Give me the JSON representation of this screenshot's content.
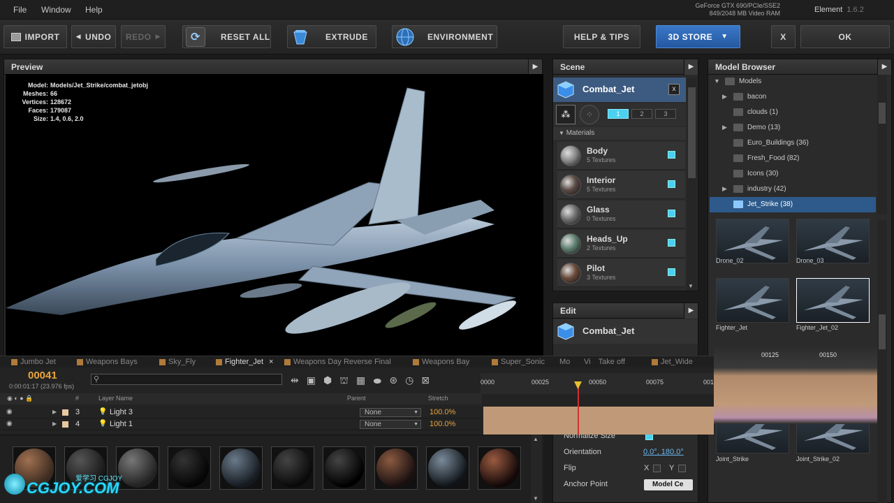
{
  "menu": {
    "file": "File",
    "window": "Window",
    "help": "Help"
  },
  "gpu": {
    "line1": "GeForce GTX 690/PCIe/SSE2",
    "line2": "849/2048 MB Video RAM"
  },
  "app": {
    "name": "Element",
    "version": "1.6.2"
  },
  "toolbar": {
    "import": "IMPORT",
    "undo": "UNDO",
    "redo": "REDO",
    "reset_all": "RESET ALL",
    "extrude": "EXTRUDE",
    "environment": "ENVIRONMENT",
    "help_tips": "HELP & TIPS",
    "store": "3D STORE",
    "close": "X",
    "ok": "OK"
  },
  "preview": {
    "title": "Preview",
    "info": [
      {
        "k": "Model:",
        "v": "Models/Jet_Strike/combat_jetobj"
      },
      {
        "k": "Meshes:",
        "v": "66"
      },
      {
        "k": "Vertices:",
        "v": "128672"
      },
      {
        "k": "Faces:",
        "v": "179087"
      },
      {
        "k": "Size:",
        "v": "1.4, 0.6, 2.0"
      }
    ]
  },
  "scene": {
    "title": "Scene",
    "object_name": "Combat_Jet",
    "close": "x",
    "groups": [
      "1",
      "2",
      "3"
    ],
    "materials_label": "Materials",
    "materials": [
      {
        "name": "Body",
        "sub": "5 Textures",
        "color": "#8a8a8a"
      },
      {
        "name": "Interior",
        "sub": "5 Textures",
        "color": "#5a4a44"
      },
      {
        "name": "Glass",
        "sub": "0 Textures",
        "color": "#707070"
      },
      {
        "name": "Heads_Up",
        "sub": "2 Textures",
        "color": "#5f8070"
      },
      {
        "name": "Pilot",
        "sub": "3 Textures",
        "color": "#6a4a3a"
      }
    ]
  },
  "edit": {
    "title": "Edit",
    "object_name": "Combat_Jet",
    "normalize_size": "Normalize Size",
    "orientation": "Orientation",
    "orientation_value": "0.0°, 180.0°",
    "flip": "Flip",
    "flip_x": "X",
    "flip_y": "Y",
    "anchor_point": "Anchor Point",
    "anchor_value": "Model Ce"
  },
  "browser": {
    "title": "Model Browser",
    "tree": [
      {
        "label": "Models",
        "indent": 0,
        "arrow": "▼",
        "state": "open"
      },
      {
        "label": "bacon",
        "indent": 1,
        "arrow": "▶",
        "state": ""
      },
      {
        "label": "clouds (1)",
        "indent": 1,
        "arrow": "",
        "state": ""
      },
      {
        "label": "Demo (13)",
        "indent": 1,
        "arrow": "▶",
        "state": ""
      },
      {
        "label": "Euro_Buildings (36)",
        "indent": 1,
        "arrow": "",
        "state": ""
      },
      {
        "label": "Fresh_Food (82)",
        "indent": 1,
        "arrow": "",
        "state": ""
      },
      {
        "label": "Icons (30)",
        "indent": 1,
        "arrow": "",
        "state": ""
      },
      {
        "label": "industry (42)",
        "indent": 1,
        "arrow": "▶",
        "state": ""
      },
      {
        "label": "Jet_Strike (38)",
        "indent": 1,
        "arrow": "",
        "state": "selected"
      }
    ],
    "thumbs": [
      {
        "label": "Drone_02"
      },
      {
        "label": "Drone_03"
      },
      {
        "label": "Fighter_Jet"
      },
      {
        "label": "Fighter_Jet_02"
      },
      {
        "label": "Joint_Strike"
      },
      {
        "label": "Joint_Strike_02"
      }
    ]
  },
  "timeline": {
    "tabs": [
      "Jumbo Jet",
      "Weapons Bays",
      "Sky_Fly",
      "Fighter_Jet",
      "Weapons Day Reverse Final",
      "Weapons Bay",
      "Super_Sonic",
      "Mo",
      "Vi",
      "Take off",
      "Jet_Wide"
    ],
    "active_tab": "Fighter_Jet",
    "timecode": "00041",
    "timecode_sub": "0:00:01:17 (23.976 fps)",
    "search_placeholder": "",
    "ruler": [
      "0000",
      "00025",
      "00050",
      "00075",
      "001",
      "00125",
      "00150"
    ],
    "header": {
      "num": "#",
      "layer_name": "Layer Name",
      "parent": "Parent",
      "stretch": "Stretch"
    },
    "layers": [
      {
        "num": "3",
        "name": "Light 3",
        "parent": "None",
        "stretch": "100.0%"
      },
      {
        "num": "4",
        "name": "Light 1",
        "parent": "None",
        "stretch": "100.0%"
      }
    ]
  },
  "material_spheres": [
    {
      "c1": "#a07050",
      "c2": "#3a2a20"
    },
    {
      "c1": "#555",
      "c2": "#181818"
    },
    {
      "c1": "#777",
      "c2": "#222"
    },
    {
      "c1": "#333",
      "c2": "#050505"
    },
    {
      "c1": "#6a7a8a",
      "c2": "#151a20"
    },
    {
      "c1": "#444",
      "c2": "#0a0a0a"
    },
    {
      "c1": "#444",
      "c2": "#000"
    },
    {
      "c1": "#8a5a40",
      "c2": "#1a1010"
    },
    {
      "c1": "#7a8a9a",
      "c2": "#101418"
    },
    {
      "c1": "#9a5a40",
      "c2": "#120808"
    }
  ],
  "watermark": {
    "text": "CGJOY.COM",
    "sub": "爱学习 CGJOY"
  }
}
